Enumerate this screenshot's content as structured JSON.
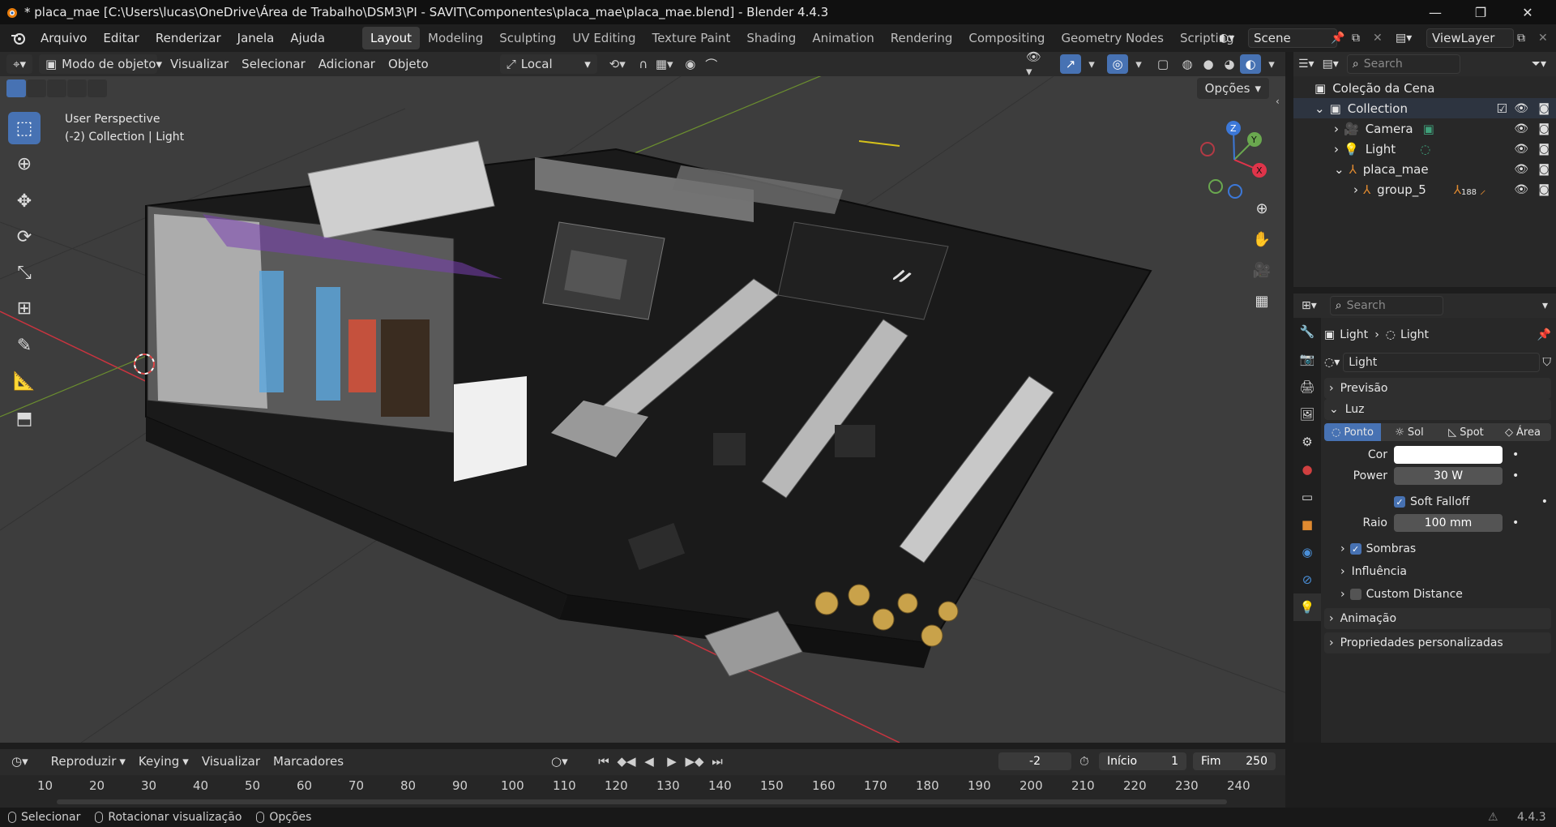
{
  "window": {
    "title": "* placa_mae [C:\\Users\\lucas\\OneDrive\\Área de Trabalho\\DSM3\\PI - SAVIT\\Componentes\\placa_mae\\placa_mae.blend] - Blender 4.4.3"
  },
  "menu": [
    "Arquivo",
    "Editar",
    "Renderizar",
    "Janela",
    "Ajuda"
  ],
  "workspaces": [
    "Layout",
    "Modeling",
    "Sculpting",
    "UV Editing",
    "Texture Paint",
    "Shading",
    "Animation",
    "Rendering",
    "Compositing",
    "Geometry Nodes",
    "Scripting"
  ],
  "active_workspace": "Layout",
  "scene": {
    "name": "Scene",
    "view_layer": "ViewLayer"
  },
  "viewport_header": {
    "mode": "Modo de objeto",
    "menus": [
      "Visualizar",
      "Selecionar",
      "Adicionar",
      "Objeto"
    ],
    "transform_orientation": "Local"
  },
  "viewport": {
    "perspective": "User Perspective",
    "collection_info": "(-2) Collection | Light",
    "options_label": "Opções",
    "axes": {
      "x": "X",
      "y": "Y",
      "z": "Z"
    }
  },
  "outliner": {
    "search_placeholder": "Search",
    "scene_collection": "Coleção da Cena",
    "items": [
      {
        "name": "Collection",
        "kind": "collection"
      },
      {
        "name": "Camera",
        "kind": "camera"
      },
      {
        "name": "Light",
        "kind": "light"
      },
      {
        "name": "placa_mae",
        "kind": "empty"
      },
      {
        "name": "group_5",
        "kind": "empty",
        "badge": "188"
      }
    ]
  },
  "properties": {
    "search_placeholder": "Search",
    "breadcrumb": [
      "Light",
      "Light"
    ],
    "datablock": "Light",
    "panels": {
      "preview": "Previsão",
      "light": "Luz",
      "animation": "Animação",
      "custom_props": "Propriedades personalizadas"
    },
    "light_types": [
      "Ponto",
      "Sol",
      "Spot",
      "Área"
    ],
    "active_light_type": "Ponto",
    "color_label": "Cor",
    "color_value": "#ffffff",
    "power_label": "Power",
    "power_value": "30 W",
    "soft_falloff_label": "Soft Falloff",
    "radius_label": "Raio",
    "radius_value": "100 mm",
    "subpanels": [
      "Sombras",
      "Influência",
      "Custom Distance"
    ]
  },
  "timeline": {
    "menus": [
      "Reproduzir",
      "Keying",
      "Visualizar",
      "Marcadores"
    ],
    "current_frame": "-2",
    "start_label": "Início",
    "start_value": "1",
    "end_label": "Fim",
    "end_value": "250",
    "ticks": [
      "10",
      "20",
      "30",
      "40",
      "50",
      "60",
      "70",
      "80",
      "90",
      "100",
      "110",
      "120",
      "130",
      "140",
      "150",
      "160",
      "170",
      "180",
      "190",
      "200",
      "210",
      "220",
      "230",
      "240"
    ]
  },
  "statusbar": {
    "items": [
      "Selecionar",
      "Rotacionar visualização",
      "Opções"
    ],
    "version": "4.4.3"
  },
  "colors": {
    "accent": "#4772b3",
    "x_axis": "#e0344a",
    "y_axis": "#6aa84f",
    "z_axis": "#3c78d8"
  }
}
